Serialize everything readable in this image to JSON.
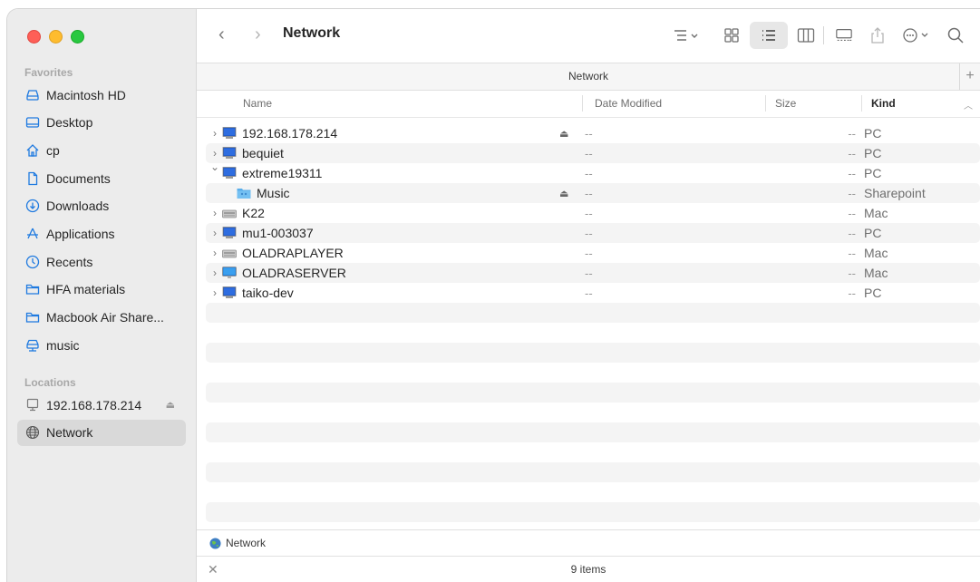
{
  "window": {
    "title": "Network"
  },
  "sidebar": {
    "favorites_header": "Favorites",
    "favorites": [
      {
        "label": "Macintosh HD",
        "icon": "drive-icon"
      },
      {
        "label": "Desktop",
        "icon": "desktop-icon"
      },
      {
        "label": "cp",
        "icon": "home-icon"
      },
      {
        "label": "Documents",
        "icon": "document-icon"
      },
      {
        "label": "Downloads",
        "icon": "download-icon"
      },
      {
        "label": "Applications",
        "icon": "applications-icon"
      },
      {
        "label": "Recents",
        "icon": "clock-icon"
      },
      {
        "label": "HFA materials",
        "icon": "folder-icon"
      },
      {
        "label": "Macbook Air Share...",
        "icon": "folder-icon"
      },
      {
        "label": "music",
        "icon": "network-drive-icon"
      }
    ],
    "locations_header": "Locations",
    "locations": [
      {
        "label": "192.168.178.214",
        "icon": "computer-icon",
        "eject": "⏏"
      },
      {
        "label": "Network",
        "icon": "globe-icon",
        "selected": true
      }
    ]
  },
  "toolbar": {
    "back": "‹",
    "forward": "›",
    "title": "Network"
  },
  "pathbar": {
    "label": "Network",
    "add": "+"
  },
  "columns": {
    "name": "Name",
    "date": "Date Modified",
    "size": "Size",
    "kind": "Kind"
  },
  "rows": [
    {
      "name": "192.168.178.214",
      "icon": "pc-icon",
      "expanded": false,
      "indent": 0,
      "eject": "⏏",
      "date": "--",
      "size": "--",
      "kind": "PC"
    },
    {
      "name": "bequiet",
      "icon": "pc-icon",
      "expanded": false,
      "indent": 0,
      "date": "--",
      "size": "--",
      "kind": "PC"
    },
    {
      "name": "extreme19311",
      "icon": "pc-icon",
      "expanded": true,
      "indent": 0,
      "date": "--",
      "size": "--",
      "kind": "PC"
    },
    {
      "name": "Music",
      "icon": "shared-folder-icon",
      "indent": 1,
      "eject": "⏏",
      "date": "--",
      "size": "--",
      "kind": "Sharepoint"
    },
    {
      "name": "K22",
      "icon": "mac-server-icon",
      "expanded": false,
      "indent": 0,
      "date": "--",
      "size": "--",
      "kind": "Mac"
    },
    {
      "name": "mu1-003037",
      "icon": "pc-icon",
      "expanded": false,
      "indent": 0,
      "date": "--",
      "size": "--",
      "kind": "PC"
    },
    {
      "name": "OLADRAPLAYER",
      "icon": "mac-server-icon",
      "expanded": false,
      "indent": 0,
      "date": "--",
      "size": "--",
      "kind": "Mac"
    },
    {
      "name": "OLADRASERVER",
      "icon": "imac-icon",
      "expanded": false,
      "indent": 0,
      "date": "--",
      "size": "--",
      "kind": "Mac"
    },
    {
      "name": "taiko-dev",
      "icon": "pc-icon",
      "expanded": false,
      "indent": 0,
      "date": "--",
      "size": "--",
      "kind": "PC"
    }
  ],
  "status": {
    "path_label": "Network",
    "item_count": "9 items",
    "close": "✕"
  }
}
